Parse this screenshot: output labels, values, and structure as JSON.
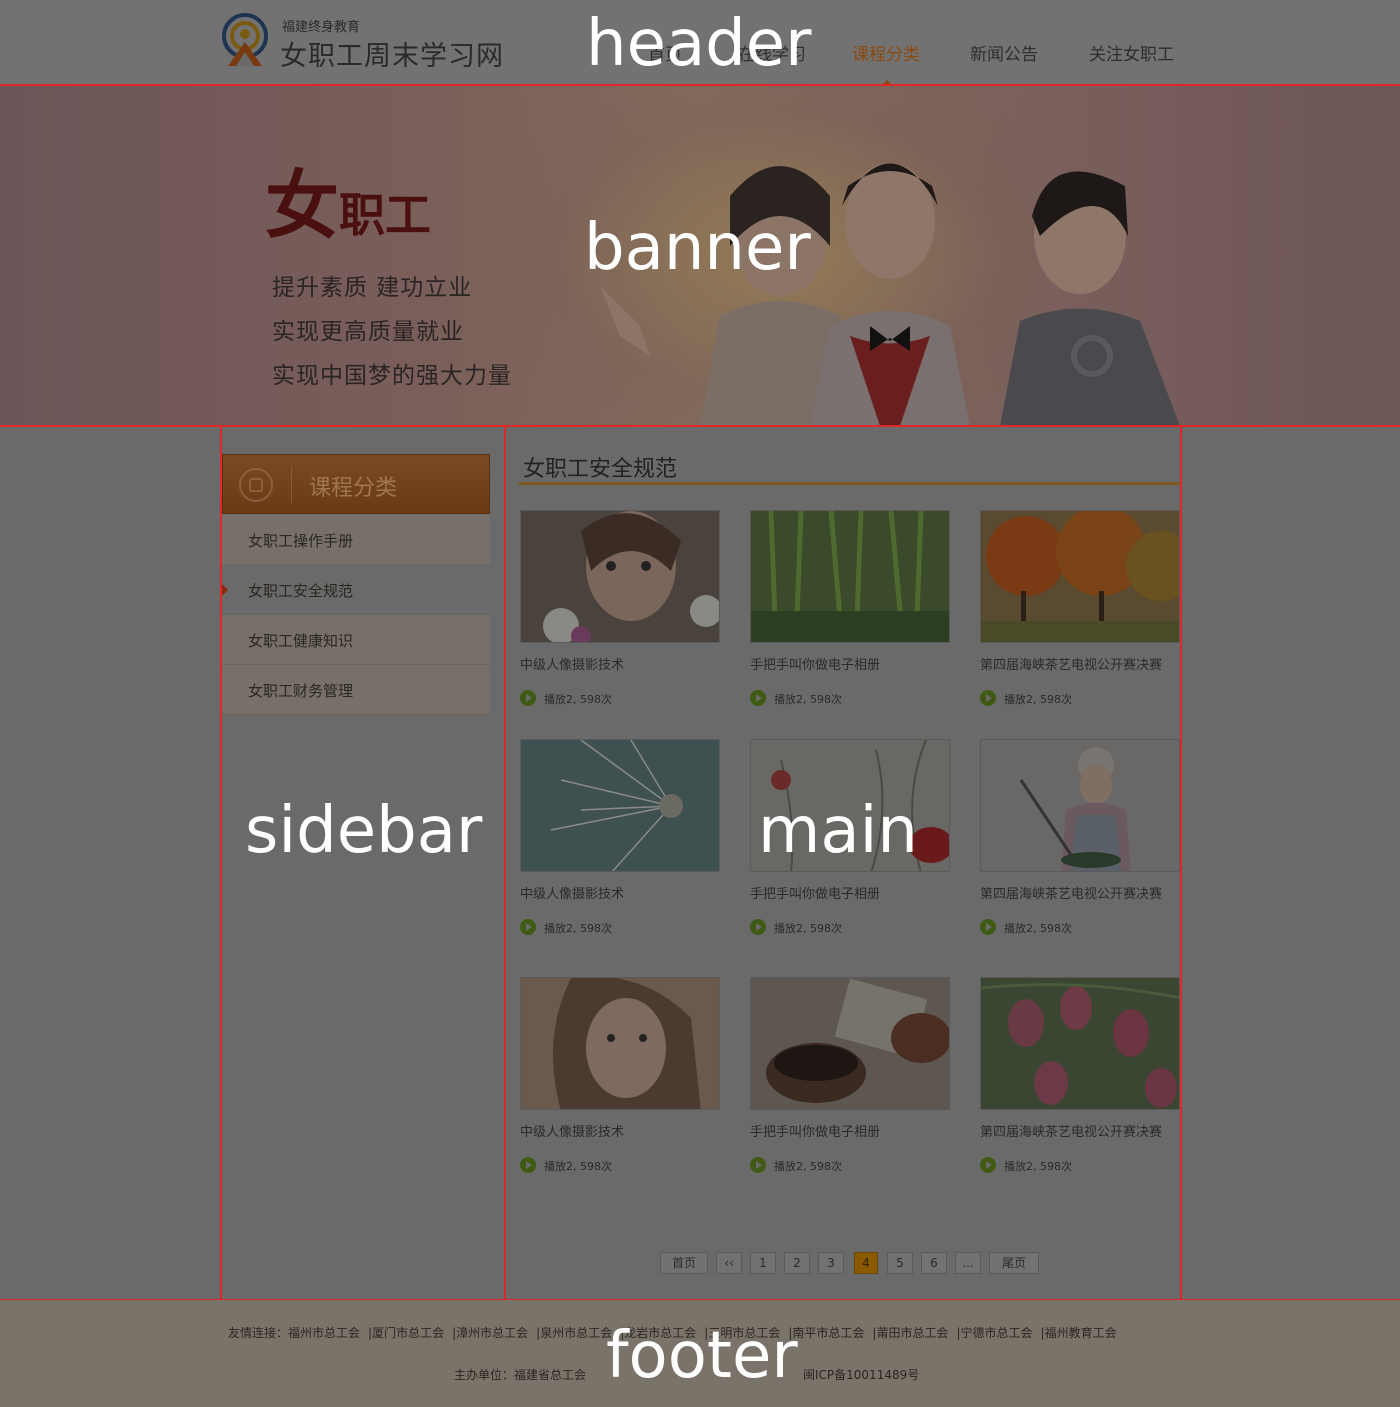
{
  "header": {
    "logo_small": "福建终身教育",
    "logo_big": "女职工周末学习网",
    "nav": [
      {
        "label": "首页"
      },
      {
        "label": "在线学习"
      },
      {
        "label": "课程分类",
        "active": true
      },
      {
        "label": "新闻公告"
      },
      {
        "label": "关注女职工"
      }
    ],
    "region_label": "header"
  },
  "banner": {
    "title_big": "女",
    "title_small": "职工",
    "lines": [
      "提升素质 建功立业",
      "实现更高质量就业",
      "实现中国梦的强大力量"
    ],
    "region_label": "banner"
  },
  "sidebar": {
    "heading": "课程分类",
    "items": [
      {
        "label": "女职工操作手册"
      },
      {
        "label": "女职工安全规范",
        "active": true
      },
      {
        "label": "女职工健康知识"
      },
      {
        "label": "女职工财务管理"
      }
    ],
    "region_label": "sidebar"
  },
  "main": {
    "title": "女职工安全规范",
    "region_label": "main",
    "cards": [
      {
        "title": "中级人像摄影技术",
        "meta": "播放2, 598次",
        "image": "girl-flowers"
      },
      {
        "title": "手把手叫你做电子相册",
        "meta": "播放2, 598次",
        "image": "willow"
      },
      {
        "title": "第四届海峡茶艺电视公开赛决赛",
        "meta": "播放2, 598次",
        "image": "autumn-trees"
      },
      {
        "title": "中级人像摄影技术",
        "meta": "播放2, 598次",
        "image": "dandelion"
      },
      {
        "title": "手把手叫你做电子相册",
        "meta": "播放2, 598次",
        "image": "red-flower"
      },
      {
        "title": "第四届海峡茶艺电视公开赛决赛",
        "meta": "播放2, 598次",
        "image": "cooking-woman"
      },
      {
        "title": "中级人像摄影技术",
        "meta": "播放2, 598次",
        "image": "girl-portrait"
      },
      {
        "title": "手把手叫你做电子相册",
        "meta": "播放2, 598次",
        "image": "tea-cup"
      },
      {
        "title": "第四届海峡茶艺电视公开赛决赛",
        "meta": "播放2, 598次",
        "image": "pink-bells"
      }
    ],
    "pagination": {
      "first": "首页",
      "prev": "‹‹",
      "pages": [
        "1",
        "2",
        "3",
        "4",
        "5",
        "6"
      ],
      "current": "4",
      "ellipsis": "...",
      "last": "尾页"
    }
  },
  "footer": {
    "links_label": "友情连接：",
    "links": [
      "福州市总工会",
      "厦门市总工会",
      "漳州市总工会",
      "泉州市总工会",
      "龙岩市总工会",
      "三明市总工会",
      "南平市总工会",
      "莆田市总工会",
      "宁德市总工会",
      "福州教育工会"
    ],
    "organizer": "主办单位：福建省总工会",
    "icp": "闽ICP备10011489号",
    "region_label": "footer"
  }
}
